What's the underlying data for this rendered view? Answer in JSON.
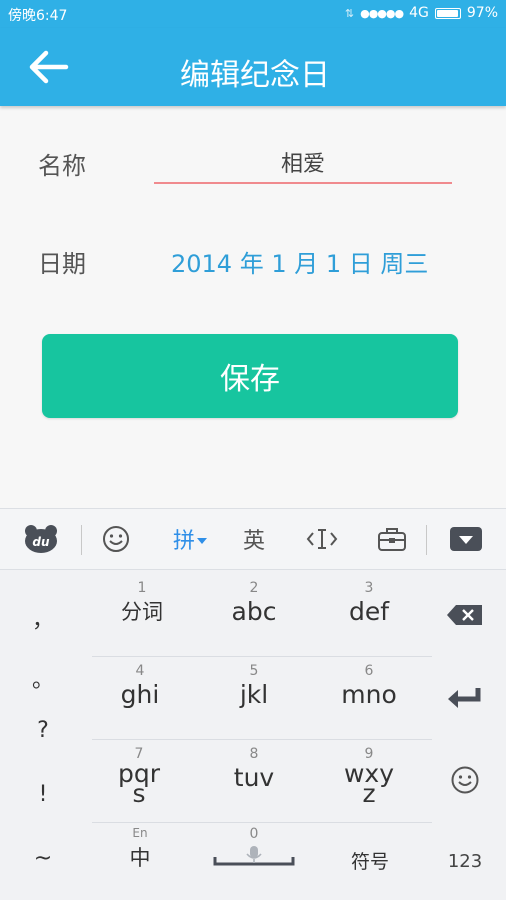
{
  "status": {
    "time": "傍晚6:47",
    "data": "⇅",
    "signal": "●●●●●",
    "network": "4G",
    "battery": "97%",
    "battery_level": 0.97
  },
  "header": {
    "title": "编辑纪念日"
  },
  "form": {
    "name_label": "名称",
    "name_value": "相爱",
    "date_label": "日期",
    "date_value": "2014 年 1 月 1 日  周三",
    "save_label": "保存"
  },
  "keyboard": {
    "toolbar": {
      "pinyin": "拼",
      "english": "英"
    },
    "keys": [
      {
        "num": "1",
        "label": "分词"
      },
      {
        "num": "2",
        "label": "abc"
      },
      {
        "num": "3",
        "label": "def"
      },
      {
        "num": "4",
        "label": "ghi"
      },
      {
        "num": "5",
        "label": "jkl"
      },
      {
        "num": "6",
        "label": "mno"
      },
      {
        "num": "7",
        "label": "pqr\ns"
      },
      {
        "num": "8",
        "label": "tuv"
      },
      {
        "num": "9",
        "label": "wxy\nz"
      }
    ],
    "punctuation": [
      "，",
      "。",
      "?",
      "!",
      "~"
    ],
    "bottom": {
      "zh_hint": "En",
      "zh": "中",
      "space_num": "0",
      "symbols": "符号",
      "numbers": "123"
    }
  }
}
